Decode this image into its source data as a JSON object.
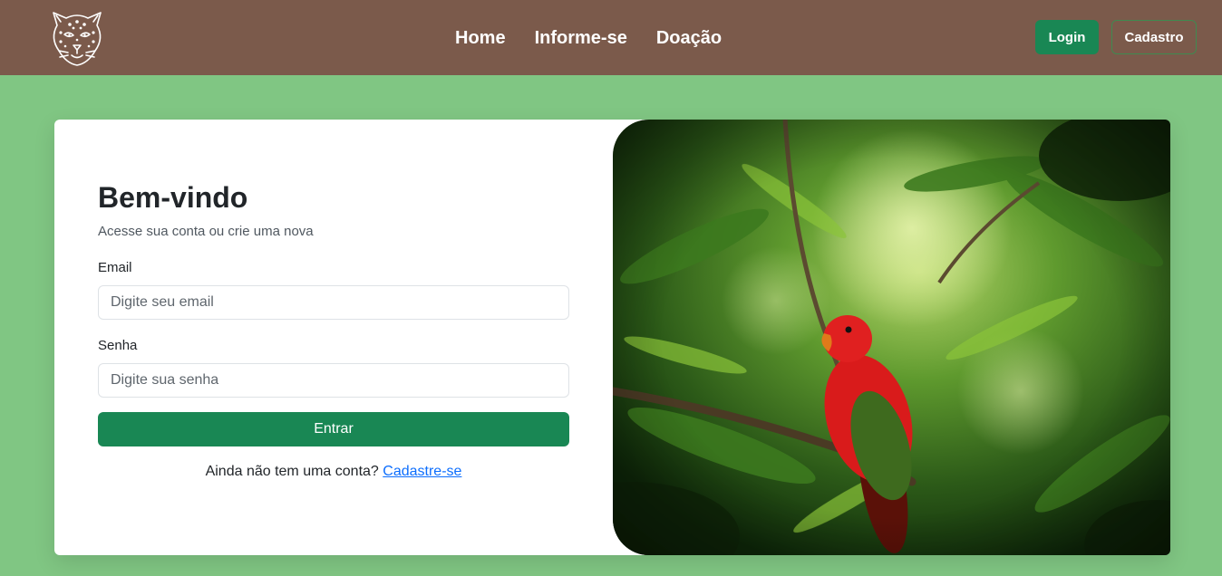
{
  "header": {
    "logo_name": "jaguar-logo",
    "nav": [
      {
        "label": "Home"
      },
      {
        "label": "Informe-se"
      },
      {
        "label": "Doação"
      }
    ],
    "login_label": "Login",
    "cadastro_label": "Cadastro",
    "colors": {
      "navbar": "#7b5a4b",
      "accent": "#198754"
    }
  },
  "login": {
    "title": "Bem-vindo",
    "subtitle": "Acesse sua conta ou crie uma nova",
    "email_label": "Email",
    "email_placeholder": "Digite seu email",
    "password_label": "Senha",
    "password_placeholder": "Digite sua senha",
    "submit_label": "Entrar",
    "signup_prompt": "Ainda não tem uma conta?",
    "signup_link": "Cadastre-se"
  },
  "hero_image": {
    "subject": "red-parrot-in-jungle"
  },
  "page": {
    "background": "#80c683"
  }
}
